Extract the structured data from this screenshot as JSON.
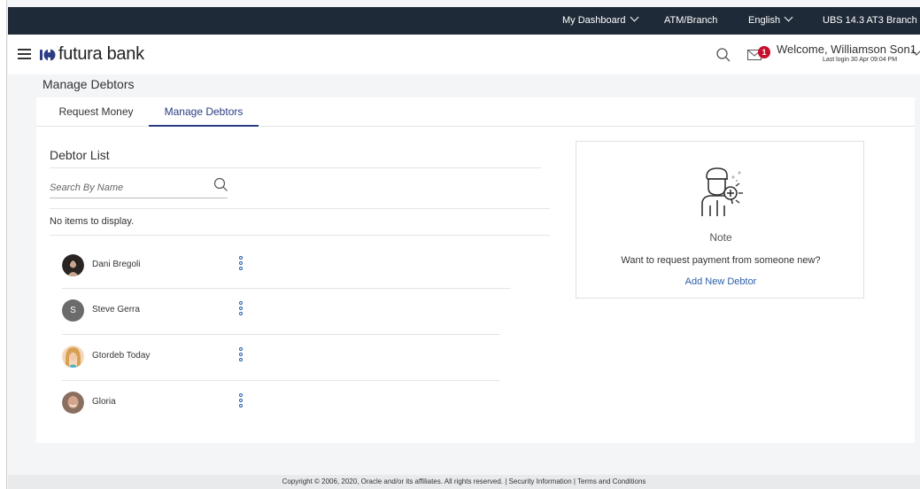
{
  "topbar": {
    "dashboard": "My Dashboard",
    "atm": "ATM/Branch",
    "language": "English",
    "branch": "UBS 14.3 AT3 Branch"
  },
  "header": {
    "brand": "futura bank",
    "notification_count": "1",
    "welcome": "Welcome, Williamson Son1",
    "last_login": "Last login 30 Apr 09:04 PM"
  },
  "page": {
    "title": "Manage Debtors"
  },
  "tabs": [
    {
      "label": "Request Money",
      "active": false
    },
    {
      "label": "Manage Debtors",
      "active": true
    }
  ],
  "debtor_list": {
    "title": "Debtor List",
    "search_placeholder": "Search By Name",
    "empty_message": "No items to display.",
    "debtors": [
      {
        "name": "Dani Bregoli",
        "avatar": "photo-dark-hair"
      },
      {
        "name": "Steve Gerra",
        "avatar": "initial",
        "initial": "S"
      },
      {
        "name": "Gtordeb Today",
        "avatar": "photo-blonde"
      },
      {
        "name": "Gloria",
        "avatar": "photo-smiling"
      }
    ]
  },
  "note": {
    "title": "Note",
    "description": "Want to request payment from someone new?",
    "link": "Add New Debtor"
  },
  "footer": {
    "text": "Copyright © 2006, 2020, Oracle and/or its affiliates. All rights reserved. | Security Information | Terms and Conditions"
  },
  "colors": {
    "topbar_bg": "#1f2a38",
    "accent": "#2b3d83",
    "link": "#2b5fa7",
    "badge": "#c8102e"
  }
}
